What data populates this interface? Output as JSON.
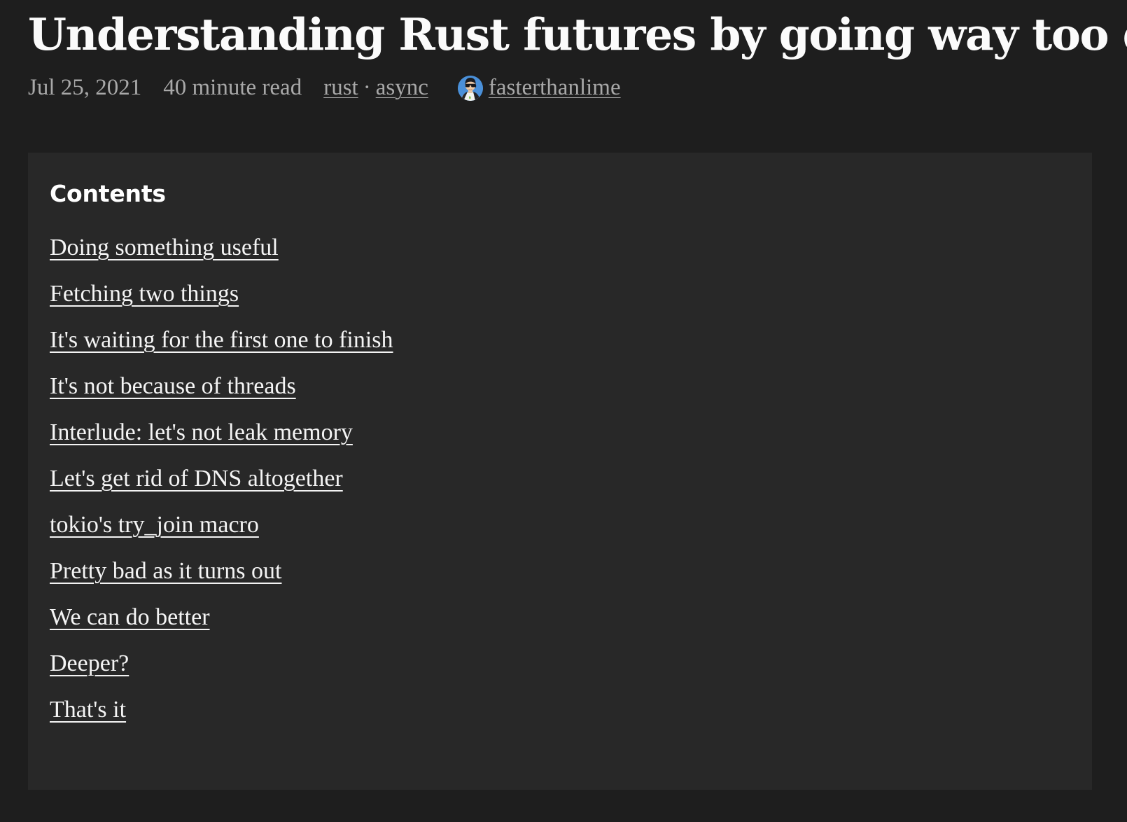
{
  "article": {
    "title": "Understanding Rust futures by going way too deep",
    "meta": {
      "date": "Jul 25, 2021",
      "read_time": "40 minute read",
      "tags": [
        "rust",
        "async"
      ],
      "tag_separator": "·",
      "author": "fasterthanlime",
      "avatar_icon": "avatar-fasterthanlime"
    }
  },
  "toc": {
    "heading": "Contents",
    "items": [
      {
        "label": "Doing something useful"
      },
      {
        "label": "Fetching two things"
      },
      {
        "label": "It's waiting for the first one to finish"
      },
      {
        "label": "It's not because of threads"
      },
      {
        "label": "Interlude: let's not leak memory"
      },
      {
        "label": "Let's get rid of DNS altogether"
      },
      {
        "label": "tokio's try_join macro"
      },
      {
        "label": "Pretty bad as it turns out"
      },
      {
        "label": "We can do better"
      },
      {
        "label": "Deeper?"
      },
      {
        "label": "That's it"
      }
    ]
  },
  "colors": {
    "page_background": "#1e1e1e",
    "panel_background": "#282828",
    "title_text": "#fbfbfb",
    "meta_text": "#a8a8a8",
    "link_text": "#f4f4f4",
    "avatar_background": "#4a90d9"
  }
}
